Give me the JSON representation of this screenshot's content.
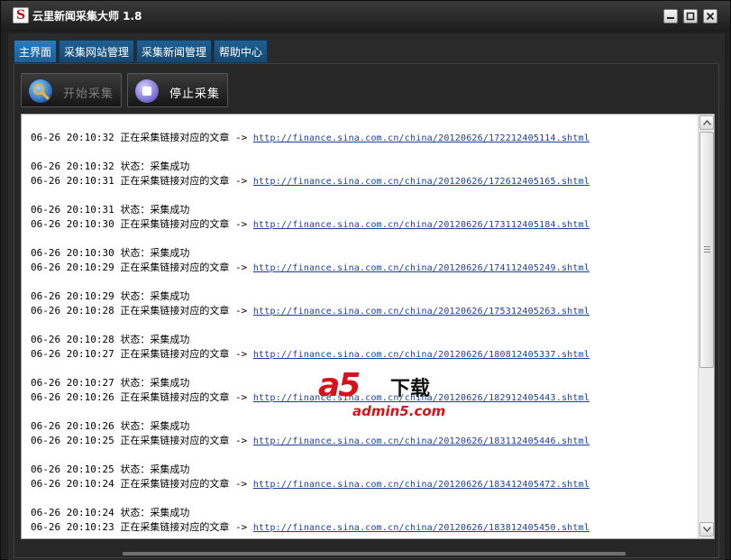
{
  "window": {
    "title": "云里新闻采集大师 1.8",
    "app_icon": "S"
  },
  "tabs": [
    {
      "label": "主界面",
      "active": true
    },
    {
      "label": "采集网站管理",
      "active": false
    },
    {
      "label": "采集新闻管理",
      "active": false
    },
    {
      "label": "帮助中心",
      "active": false
    }
  ],
  "toolbar": {
    "start_label": "开始采集",
    "stop_label": "停止采集"
  },
  "log": {
    "entries": [
      {
        "status": "",
        "action": "06-26 20:10:32 正在采集链接对应的文章 -> ",
        "url": "http://finance.sina.com.cn/china/20120626/172212405114.shtml"
      },
      {
        "status": "06-26 20:10:32 状态：采集成功",
        "action": "06-26 20:10:31 正在采集链接对应的文章 -> ",
        "url": "http://finance.sina.com.cn/china/20120626/172612405165.shtml"
      },
      {
        "status": "06-26 20:10:31 状态：采集成功",
        "action": "06-26 20:10:30 正在采集链接对应的文章 -> ",
        "url": "http://finance.sina.com.cn/china/20120626/173112405184.shtml"
      },
      {
        "status": "06-26 20:10:30 状态：采集成功",
        "action": "06-26 20:10:29 正在采集链接对应的文章 -> ",
        "url": "http://finance.sina.com.cn/china/20120626/174112405249.shtml"
      },
      {
        "status": "06-26 20:10:29 状态：采集成功",
        "action": "06-26 20:10:28 正在采集链接对应的文章 -> ",
        "url": "http://finance.sina.com.cn/china/20120626/175312405263.shtml"
      },
      {
        "status": "06-26 20:10:28 状态：采集成功",
        "action": "06-26 20:10:27 正在采集链接对应的文章 -> ",
        "url": "http://finance.sina.com.cn/china/20120626/180812405337.shtml"
      },
      {
        "status": "06-26 20:10:27 状态：采集成功",
        "action": "06-26 20:10:26 正在采集链接对应的文章 -> ",
        "url": "http://finance.sina.com.cn/china/20120626/182912405443.shtml"
      },
      {
        "status": "06-26 20:10:26 状态：采集成功",
        "action": "06-26 20:10:25 正在采集链接对应的文章 -> ",
        "url": "http://finance.sina.com.cn/china/20120626/183112405446.shtml"
      },
      {
        "status": "06-26 20:10:25 状态：采集成功",
        "action": "06-26 20:10:24 正在采集链接对应的文章 -> ",
        "url": "http://finance.sina.com.cn/china/20120626/183412405472.shtml"
      },
      {
        "status": "06-26 20:10:24 状态：采集成功",
        "action": "06-26 20:10:23 正在采集链接对应的文章 -> ",
        "url": "http://finance.sina.com.cn/china/20120626/183812405450.shtml"
      }
    ]
  },
  "watermark": {
    "logo": "a5",
    "label": "下载",
    "url": "admin5.com"
  },
  "colors": {
    "tab_bg": "#1e5f93",
    "link": "#1c3f97",
    "watermark_red": "#d7121a"
  },
  "icons": [
    "app-logo-icon",
    "minimize-icon",
    "maximize-icon",
    "close-icon",
    "search-globe-icon",
    "stop-icon",
    "scroll-up-icon",
    "scroll-down-icon"
  ]
}
